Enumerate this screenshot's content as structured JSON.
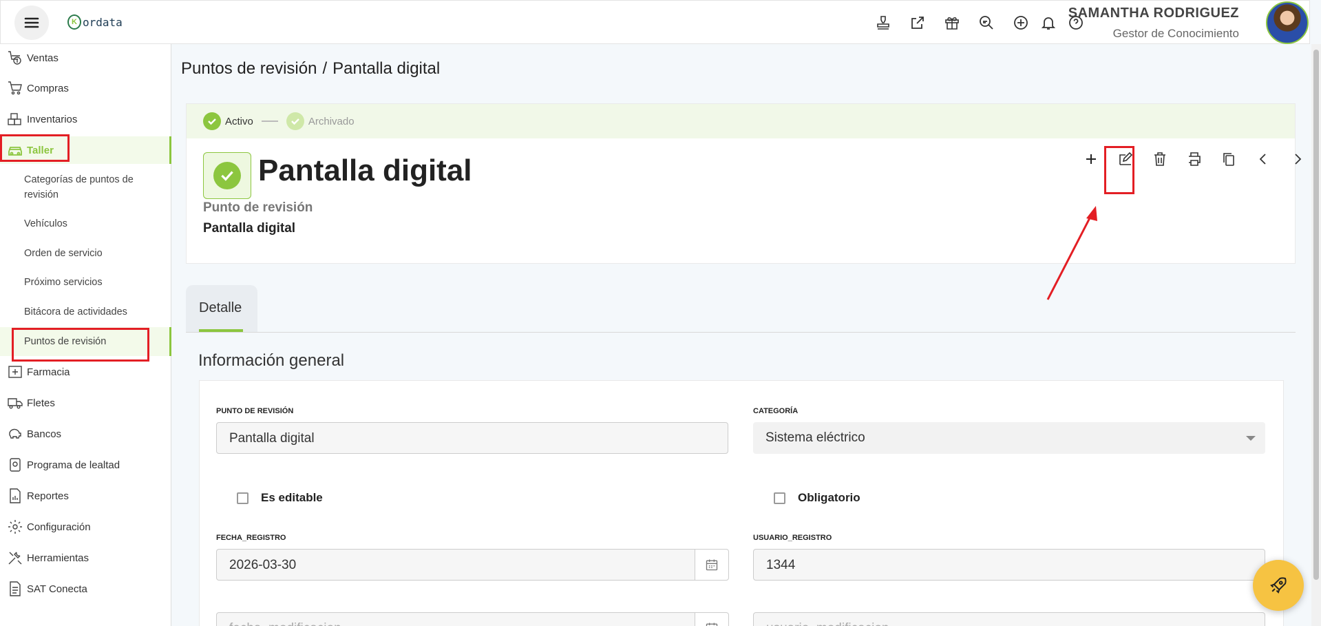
{
  "header": {
    "logo_text": "ordata",
    "logo_mark": "K",
    "icons": [
      "stamp-icon",
      "external-link-icon",
      "gift-icon",
      "search-zoom-icon",
      "add-circle-icon",
      "bell-icon",
      "help-icon"
    ],
    "user_name": "SAMANTHA RODRIGUEZ",
    "user_role": "Gestor de Conocimiento"
  },
  "sidebar": {
    "items": [
      {
        "label": "Ventas",
        "icon": "sales-icon"
      },
      {
        "label": "Compras",
        "icon": "cart-icon"
      },
      {
        "label": "Inventarios",
        "icon": "boxes-icon"
      },
      {
        "label": "Taller",
        "icon": "car-icon"
      },
      {
        "label": "Farmacia",
        "icon": "pharmacy-icon"
      },
      {
        "label": "Fletes",
        "icon": "truck-icon"
      },
      {
        "label": "Bancos",
        "icon": "piggy-bank-icon"
      },
      {
        "label": "Programa de lealtad",
        "icon": "loyalty-icon"
      },
      {
        "label": "Reportes",
        "icon": "report-icon"
      },
      {
        "label": "Configuración",
        "icon": "gear-icon"
      },
      {
        "label": "Herramientas",
        "icon": "tools-icon"
      },
      {
        "label": "SAT Conecta",
        "icon": "document-icon"
      }
    ],
    "subitems": [
      {
        "label": "Categorías de puntos de revisión"
      },
      {
        "label": "Vehículos"
      },
      {
        "label": "Orden de servicio"
      },
      {
        "label": "Próximo servicios"
      },
      {
        "label": "Bitácora de actividades"
      },
      {
        "label": "Puntos de revisión"
      }
    ]
  },
  "breadcrumb": {
    "parent": "Puntos de revisión",
    "sep": "/",
    "current": "Pantalla digital"
  },
  "status": {
    "active": "Activo",
    "archived": "Archivado"
  },
  "record": {
    "title": "Pantalla digital",
    "type_label": "Punto de revisión",
    "name": "Pantalla digital"
  },
  "actions": [
    "add-icon",
    "edit-icon",
    "trash-icon",
    "print-icon",
    "copy-icon",
    "chevron-left-icon",
    "chevron-right-icon"
  ],
  "tabs": [
    {
      "label": "Detalle"
    }
  ],
  "form": {
    "section_title": "Información general",
    "punto_label": "PUNTO DE REVISIÓN",
    "punto_value": "Pantalla digital",
    "categoria_label": "CATEGORÍA",
    "categoria_value": "Sistema eléctrico",
    "editable_label": "Es editable",
    "obligatorio_label": "Obligatorio",
    "fecha_label": "FECHA_REGISTRO",
    "fecha_value": "2026-03-30",
    "usuario_label": "USUARIO_REGISTRO",
    "usuario_value": "1344",
    "fecha_mod_placeholder": "fecha_modificacion",
    "usuario_mod_placeholder": "usuario_modificacion"
  },
  "colors": {
    "accent": "#8cc63f",
    "highlight": "#e31e24",
    "fab": "#f6c342"
  }
}
